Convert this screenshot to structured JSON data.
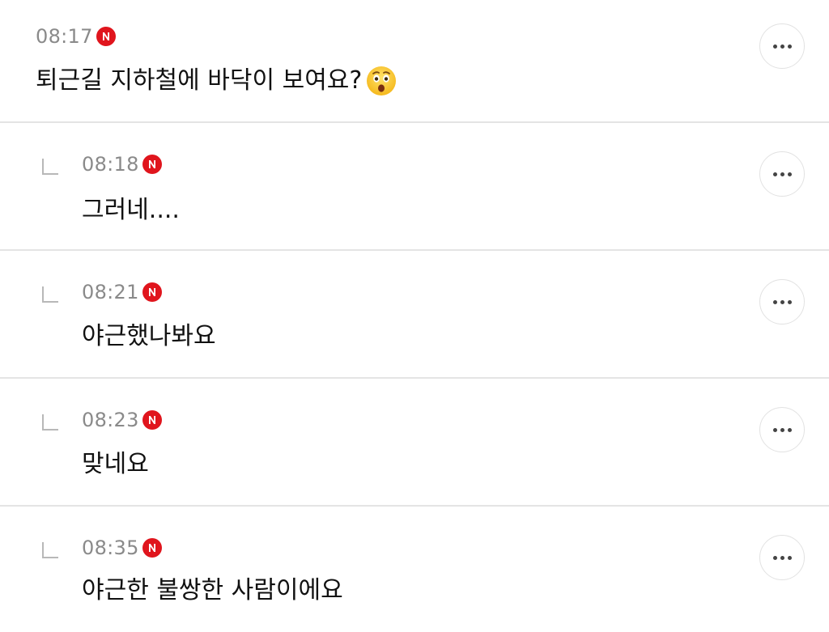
{
  "comments": [
    {
      "time": "08:17",
      "text": "퇴근길 지하철에 바닥이 보여요?",
      "emoji": "astonished-face",
      "is_reply": false
    },
    {
      "time": "08:18",
      "text": "그러네....",
      "is_reply": true
    },
    {
      "time": "08:21",
      "text": "야근했나봐요",
      "is_reply": true
    },
    {
      "time": "08:23",
      "text": "맞네요",
      "is_reply": true
    },
    {
      "time": "08:35",
      "text": "야근한 불쌍한 사람이에요",
      "is_reply": true
    }
  ],
  "badge_label": "N",
  "colors": {
    "badge": "#e0151d",
    "time": "#8a8a8a",
    "divider": "#e4e4e4",
    "text": "#111111"
  },
  "icons": {
    "reply": "reply-corner-icon",
    "badge": "n-badge-icon",
    "more": "more-dots-icon"
  }
}
